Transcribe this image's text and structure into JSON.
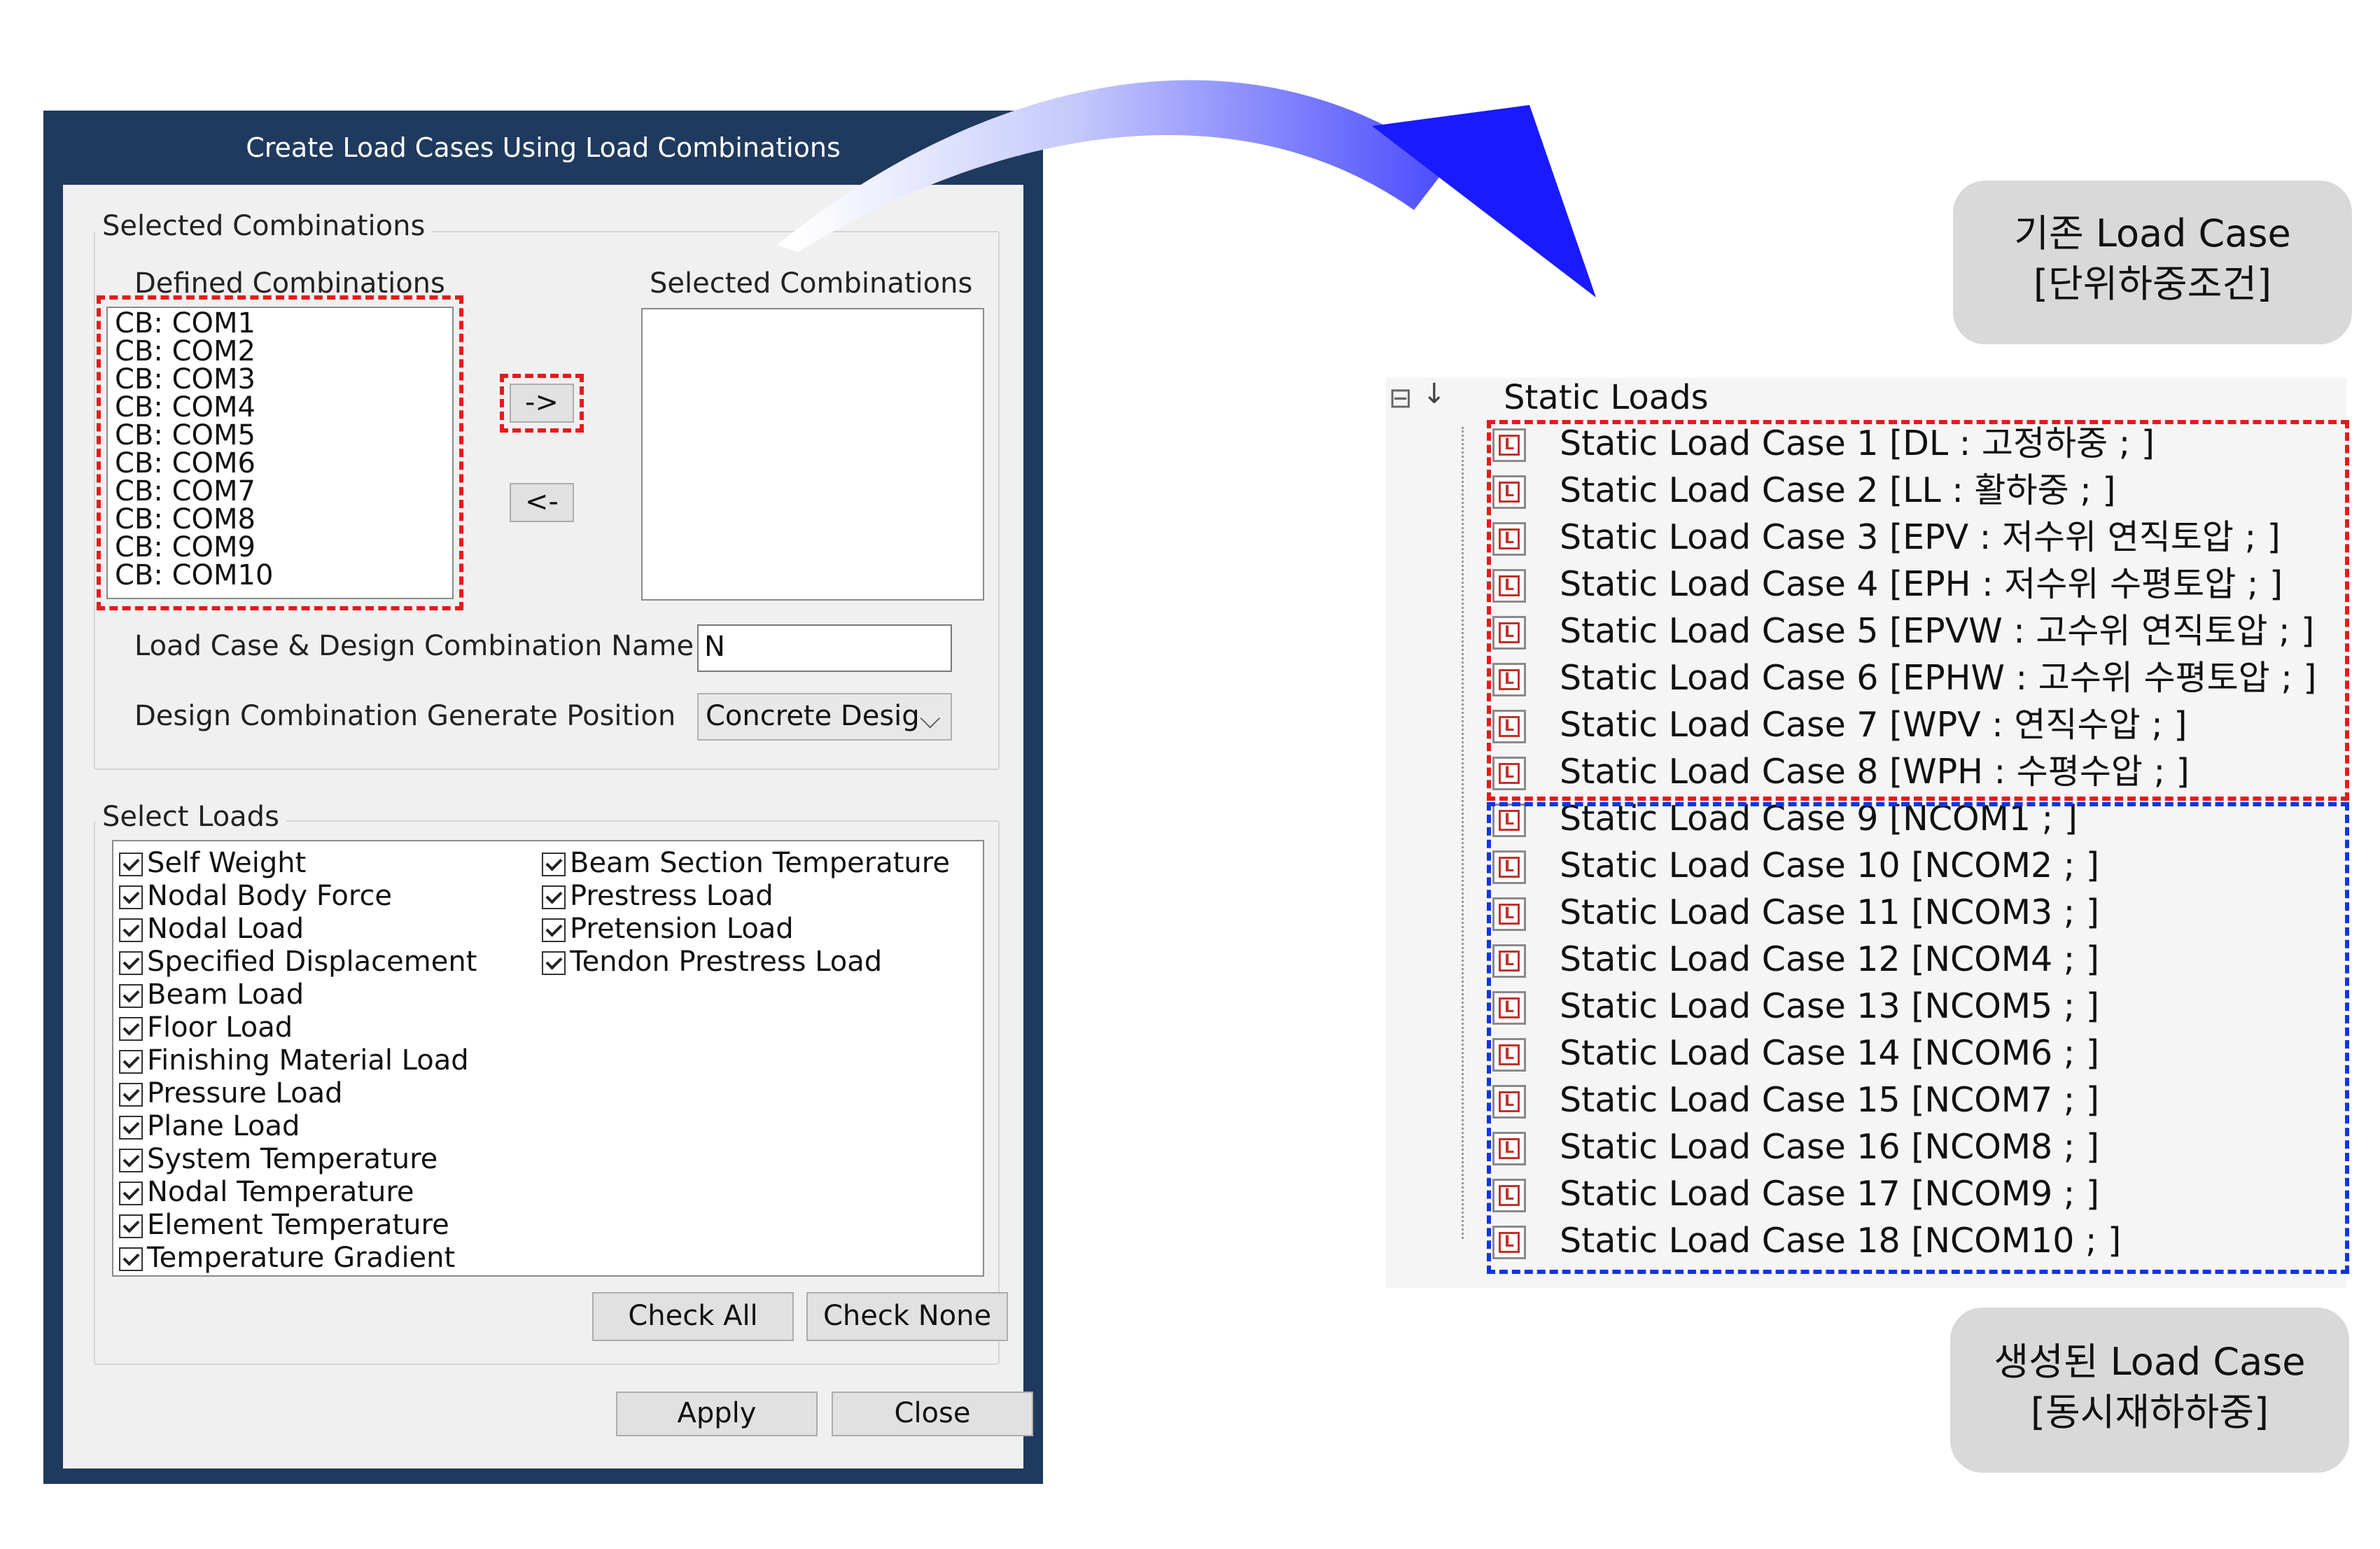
{
  "dialog": {
    "title": "Create Load Cases Using Load Combinations",
    "close_glyph": "✕",
    "selected_group": {
      "title": "Selected Combinations",
      "defined_label": "Defined Combinations",
      "selected_label": "Selected Combinations",
      "defined_items": [
        "CB: COM1",
        "CB: COM2",
        "CB: COM3",
        "CB: COM4",
        "CB: COM5",
        "CB: COM6",
        "CB: COM7",
        "CB: COM8",
        "CB: COM9",
        "CB: COM10"
      ],
      "add_button": "->",
      "remove_button": "<-",
      "name_label": "Load Case & Design Combination Name",
      "name_value": "N",
      "position_label": "Design Combination Generate Position",
      "position_value": "Concrete Desig"
    },
    "select_loads": {
      "title": "Select Loads",
      "left_items": [
        "Self Weight",
        "Nodal Body Force",
        "Nodal Load",
        "Specified Displacement",
        "Beam Load",
        "Floor Load",
        "Finishing Material Load",
        "Pressure Load",
        "Plane Load",
        "System Temperature",
        "Nodal Temperature",
        "Element Temperature",
        "Temperature Gradient"
      ],
      "right_items": [
        "Beam Section Temperature",
        "Prestress Load",
        "Pretension Load",
        "Tendon Prestress Load"
      ],
      "check_all": "Check All",
      "check_none": "Check None"
    },
    "apply": "Apply",
    "close": "Close"
  },
  "tree": {
    "root_label": "Static Loads",
    "expand_glyph": "⊟",
    "icon_letter": "L",
    "items": [
      "Static Load Case 1 [DL : 고정하중 ; ]",
      "Static Load Case 2 [LL : 활하중 ; ]",
      "Static Load Case 3 [EPV : 저수위 연직토압 ; ]",
      "Static Load Case 4 [EPH : 저수위 수평토압 ; ]",
      "Static Load Case 5 [EPVW : 고수위 연직토압 ; ]",
      "Static Load Case 6 [EPHW : 고수위 수평토압 ; ]",
      "Static Load Case 7 [WPV : 연직수압 ; ]",
      "Static Load Case 8 [WPH : 수평수압 ; ]",
      "Static Load Case 9 [NCOM1 ; ]",
      "Static Load Case 10 [NCOM2 ; ]",
      "Static Load Case 11 [NCOM3 ; ]",
      "Static Load Case 12 [NCOM4 ; ]",
      "Static Load Case 13 [NCOM5 ; ]",
      "Static Load Case 14 [NCOM6 ; ]",
      "Static Load Case 15 [NCOM7 ; ]",
      "Static Load Case 16 [NCOM8 ; ]",
      "Static Load Case 17 [NCOM9 ; ]",
      "Static Load Case 18 [NCOM10 ; ]"
    ]
  },
  "badges": {
    "existing_line1": "기존 Load Case",
    "existing_line2": "[단위하중조건]",
    "generated_line1": "생성된 Load Case",
    "generated_line2": "[동시재하하중]"
  },
  "colors": {
    "titlebar": "#1f3a5e",
    "highlight_red": "#e8191c",
    "highlight_blue": "#1233e8",
    "arrow_blue": "#1a1aff"
  }
}
